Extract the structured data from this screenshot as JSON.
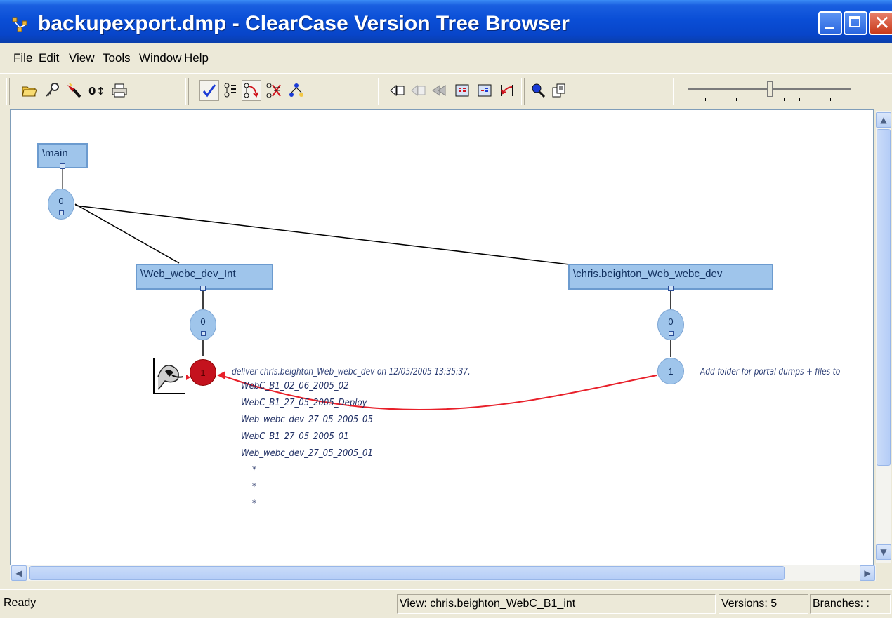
{
  "window": {
    "title": "backupexport.dmp - ClearCase Version Tree Browser"
  },
  "menu": {
    "items": [
      {
        "label": "File"
      },
      {
        "label": "Edit"
      },
      {
        "label": "View"
      },
      {
        "label": "Tools"
      },
      {
        "label": "Window"
      },
      {
        "label": "Help"
      }
    ]
  },
  "toolbar": {
    "icons": [
      "open-folder-icon",
      "key-icon",
      "flashlight-icon",
      "version-sort-icon",
      "print-icon",
      "checkmark-icon",
      "show-labels-icon",
      "show-merges-icon",
      "collapse-branches-icon",
      "tree-layout-icon",
      "back-icon",
      "forward-icon",
      "rewind-icon",
      "compare-icon",
      "diff-icon",
      "merge-arrow-icon",
      "find-icon",
      "copy-icon"
    ],
    "zoom_level": 0.5
  },
  "tree": {
    "branches": [
      {
        "label": "\\main"
      },
      {
        "label": "\\Web_webc_dev_Int"
      },
      {
        "label": "\\chris.beighton_Web_webc_dev"
      }
    ],
    "versions": [
      {
        "branch": "\\main",
        "number": "0"
      },
      {
        "branch": "\\Web_webc_dev_Int",
        "number": "0"
      },
      {
        "branch": "\\Web_webc_dev_Int",
        "number": "1",
        "selected": true
      },
      {
        "branch": "\\chris.beighton_Web_webc_dev",
        "number": "0"
      },
      {
        "branch": "\\chris.beighton_Web_webc_dev",
        "number": "1"
      }
    ],
    "deliver_comment": "deliver chris.beighton_Web_webc_dev on 12/05/2005 13:35:37.",
    "labels": [
      "WebC_B1_02_06_2005_02",
      "WebC_B1_27_05_2005_Deploy",
      "Web_webc_dev_27_05_2005_05",
      "WebC_B1_27_05_2005_01",
      "Web_webc_dev_27_05_2005_01",
      "*",
      "*",
      "*"
    ],
    "dev_comment": "Add folder for portal dumps + files to",
    "merge_color": "#e8202a",
    "node_color": "#9fc5eb",
    "selected_color": "#c4121e"
  },
  "status": {
    "message": "Ready",
    "view": "View:  chris.beighton_WebC_B1_int",
    "versions": "Versions:  5",
    "branches": "Branches: :"
  }
}
